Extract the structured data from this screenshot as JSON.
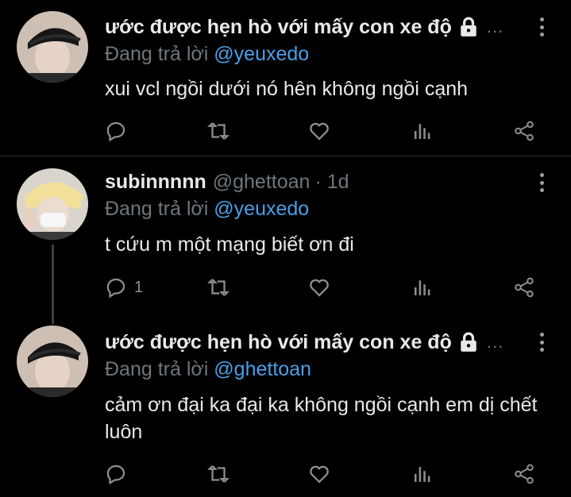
{
  "tweets": [
    {
      "name": "ước được hẹn hò với mấy con xe độ",
      "handle": "",
      "time": "",
      "locked": true,
      "truncated_mark": "...",
      "reply_prefix": "Đang trả lời ",
      "reply_to": "@yeuxedo",
      "text": "xui vcl ngồi dưới nó hên không ngồi cạnh",
      "reply_count": ""
    },
    {
      "name": "subinnnnn",
      "handle": "@ghettoan",
      "time": "· 1d",
      "locked": false,
      "truncated_mark": "",
      "reply_prefix": "Đang trả lời ",
      "reply_to": "@yeuxedo",
      "text": "t cứu m một mạng biết ơn đi",
      "reply_count": "1"
    },
    {
      "name": "ước được hẹn hò với mấy con xe độ",
      "handle": "",
      "time": "",
      "locked": true,
      "truncated_mark": "...",
      "reply_prefix": "Đang trả lời ",
      "reply_to": "@ghettoan",
      "text": "cảm ơn đại ka đại ka không ngồi cạnh em dị chết luôn",
      "reply_count": ""
    }
  ],
  "icons": {
    "reply": "reply-icon",
    "retweet": "retweet-icon",
    "like": "heart-icon",
    "analytics": "analytics-icon",
    "share": "share-icon",
    "more": "more-vertical-icon",
    "lock": "lock-icon"
  },
  "colors": {
    "background": "#000000",
    "text": "#e7e9ea",
    "muted": "#6e767d",
    "mention": "#4a9fe8",
    "divider": "#2f3336"
  }
}
